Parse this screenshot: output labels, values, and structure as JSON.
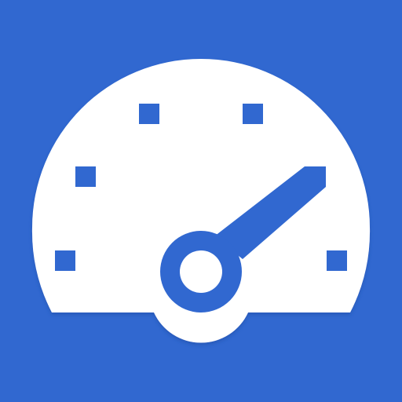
{
  "icon": {
    "name": "speedometer-icon",
    "background_color": "#3168D0",
    "foreground_color": "#FFFFFF",
    "shadow_color": "#1F4FA8"
  }
}
